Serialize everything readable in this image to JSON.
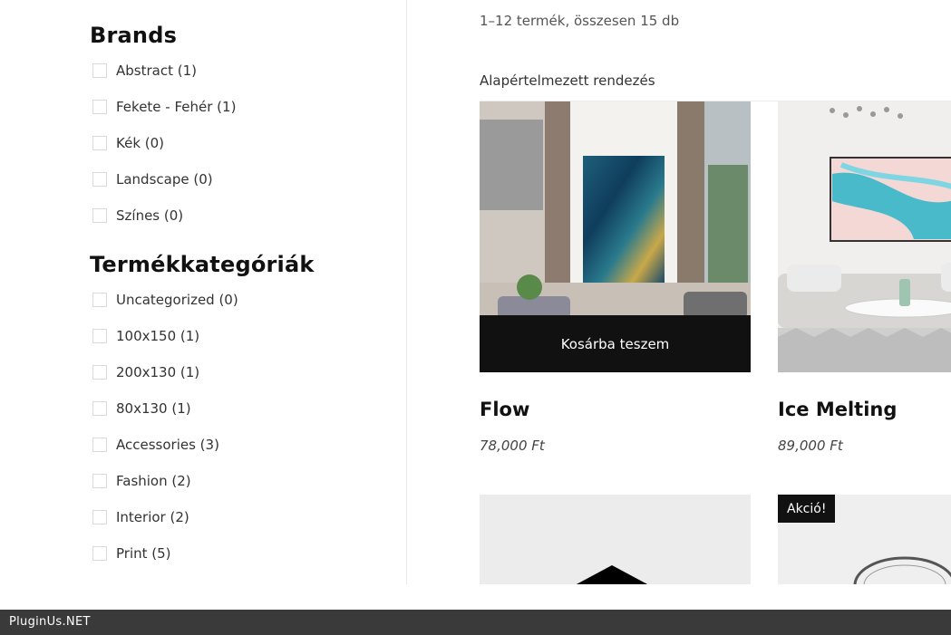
{
  "sidebar": {
    "brands_title": "Brands",
    "brands": [
      {
        "label": "Abstract (1)"
      },
      {
        "label": "Fekete - Fehér (1)"
      },
      {
        "label": "Kék (0)"
      },
      {
        "label": "Landscape (0)"
      },
      {
        "label": "Színes (0)"
      }
    ],
    "categories_title": "Termékkategóriák",
    "categories": [
      {
        "label": "Uncategorized (0)"
      },
      {
        "label": "100x150 (1)"
      },
      {
        "label": "200x130 (1)"
      },
      {
        "label": "80x130 (1)"
      },
      {
        "label": "Accessories (3)"
      },
      {
        "label": "Fashion (2)"
      },
      {
        "label": "Interior (2)"
      },
      {
        "label": "Print (5)"
      }
    ]
  },
  "main": {
    "result_count": "1–12 termék, összesen 15 db",
    "ordering": "Alapértelmezett rendezés",
    "products": [
      {
        "title": "Flow",
        "price": "78,000 Ft",
        "cart_label": "Kosárba teszem"
      },
      {
        "title": "Ice Melting",
        "price": "89,000 Ft"
      },
      {
        "title": ""
      },
      {
        "title": "",
        "badge": "Akció!"
      }
    ]
  },
  "footer": {
    "text": "PluginUs.NET"
  }
}
